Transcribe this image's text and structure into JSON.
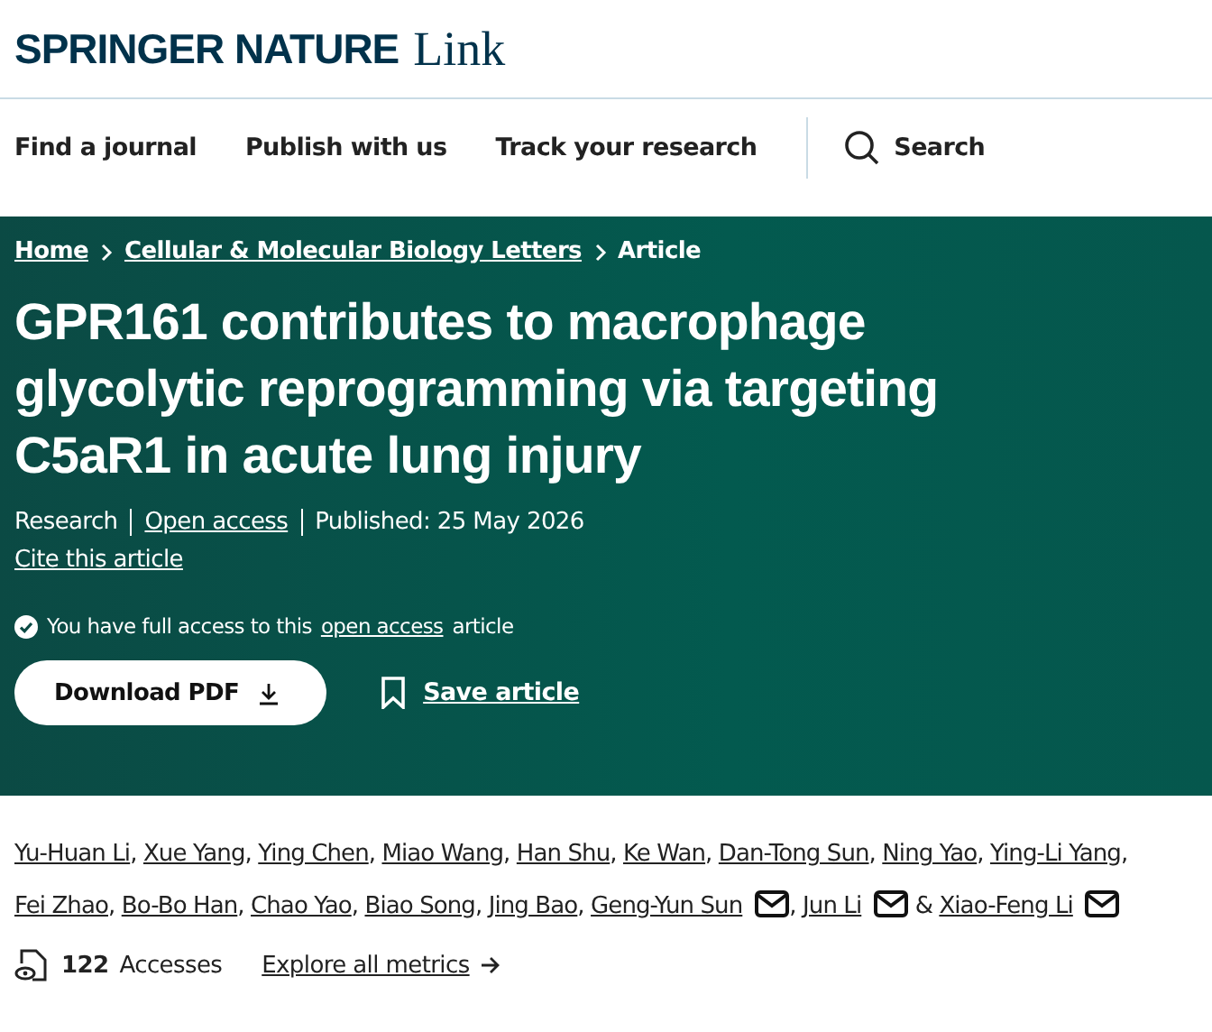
{
  "header": {
    "brand": "SPRINGER NATURE",
    "product": "Link"
  },
  "nav": {
    "items": [
      "Find a journal",
      "Publish with us",
      "Track your research"
    ],
    "search": "Search"
  },
  "breadcrumbs": [
    "Home",
    "Cellular & Molecular Biology Letters",
    "Article"
  ],
  "title": "GPR161 contributes to macrophage glycolytic reprogramming via targeting C5aR1 in acute lung injury",
  "meta": {
    "type": "Research",
    "access": "Open access",
    "published": "Published: 25 May 2026"
  },
  "cite": "Cite this article",
  "access_note": {
    "before": "You have full access to this",
    "link": "open access",
    "after": "article"
  },
  "actions": {
    "download": "Download PDF",
    "save": "Save article"
  },
  "authors": [
    {
      "name": "Yu-Huan Li",
      "email": false,
      "after": ","
    },
    {
      "name": "Xue Yang",
      "email": false,
      "after": ","
    },
    {
      "name": "Ying Chen",
      "email": false,
      "after": ","
    },
    {
      "name": "Miao Wang",
      "email": false,
      "after": ","
    },
    {
      "name": "Han Shu",
      "email": false,
      "after": ","
    },
    {
      "name": "Ke Wan",
      "email": false,
      "after": ","
    },
    {
      "name": "Dan-Tong Sun",
      "email": false,
      "after": ","
    },
    {
      "name": "Ning Yao",
      "email": false,
      "after": ","
    },
    {
      "name": "Ying-Li Yang",
      "email": false,
      "after": ","
    },
    {
      "name": "Fei Zhao",
      "email": false,
      "after": ","
    },
    {
      "name": "Bo-Bo Han",
      "email": false,
      "after": ","
    },
    {
      "name": "Chao Yao",
      "email": false,
      "after": ","
    },
    {
      "name": "Biao Song",
      "email": false,
      "after": ","
    },
    {
      "name": "Jing Bao",
      "email": false,
      "after": ","
    },
    {
      "name": "Geng-Yun Sun",
      "email": true,
      "after": ","
    },
    {
      "name": "Jun Li",
      "email": true,
      "after": "&"
    },
    {
      "name": "Xiao-Feng Li",
      "email": true
    }
  ],
  "metrics": {
    "count": "122",
    "label": "Accesses",
    "link": "Explore all metrics"
  }
}
